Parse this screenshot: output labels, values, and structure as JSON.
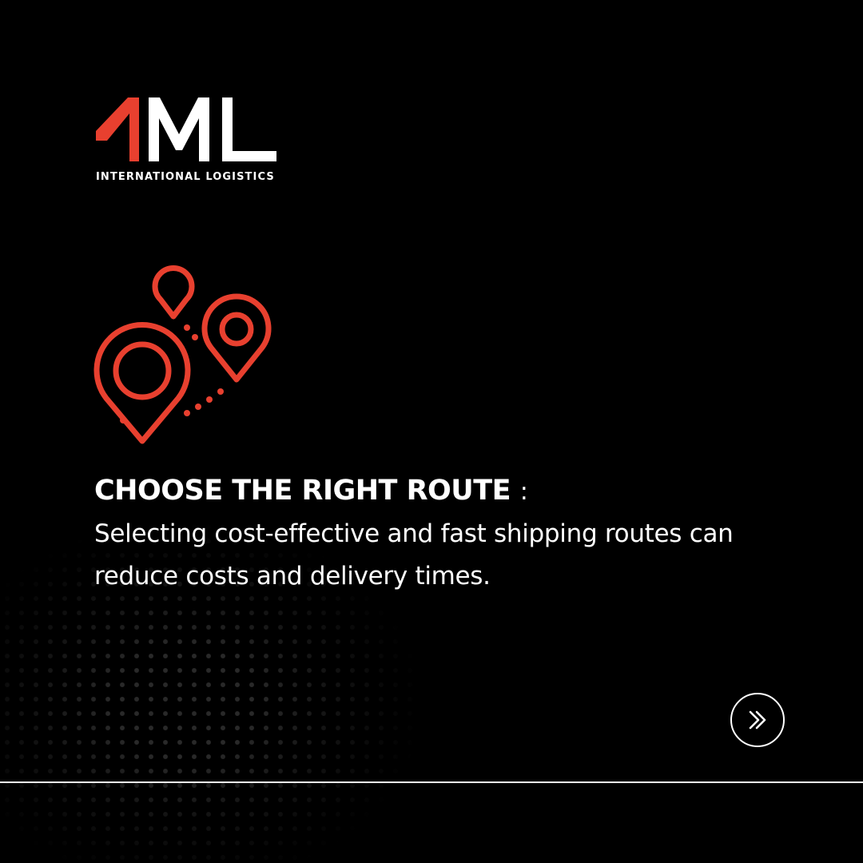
{
  "brand": {
    "logo_text": "1ML",
    "tagline": "INTERNATIONAL LOGISTICS"
  },
  "headline": {
    "title": "CHOOSE THE RIGHT ROUTE",
    "separator": ":"
  },
  "body": {
    "text": "Selecting cost-effective and fast shipping routes can reduce costs and delivery times."
  },
  "icons": {
    "route": "route-map-pins-icon",
    "next": "double-chevron-right-icon"
  },
  "colors": {
    "accent": "#e8402f",
    "text": "#ffffff",
    "background": "#000000"
  }
}
